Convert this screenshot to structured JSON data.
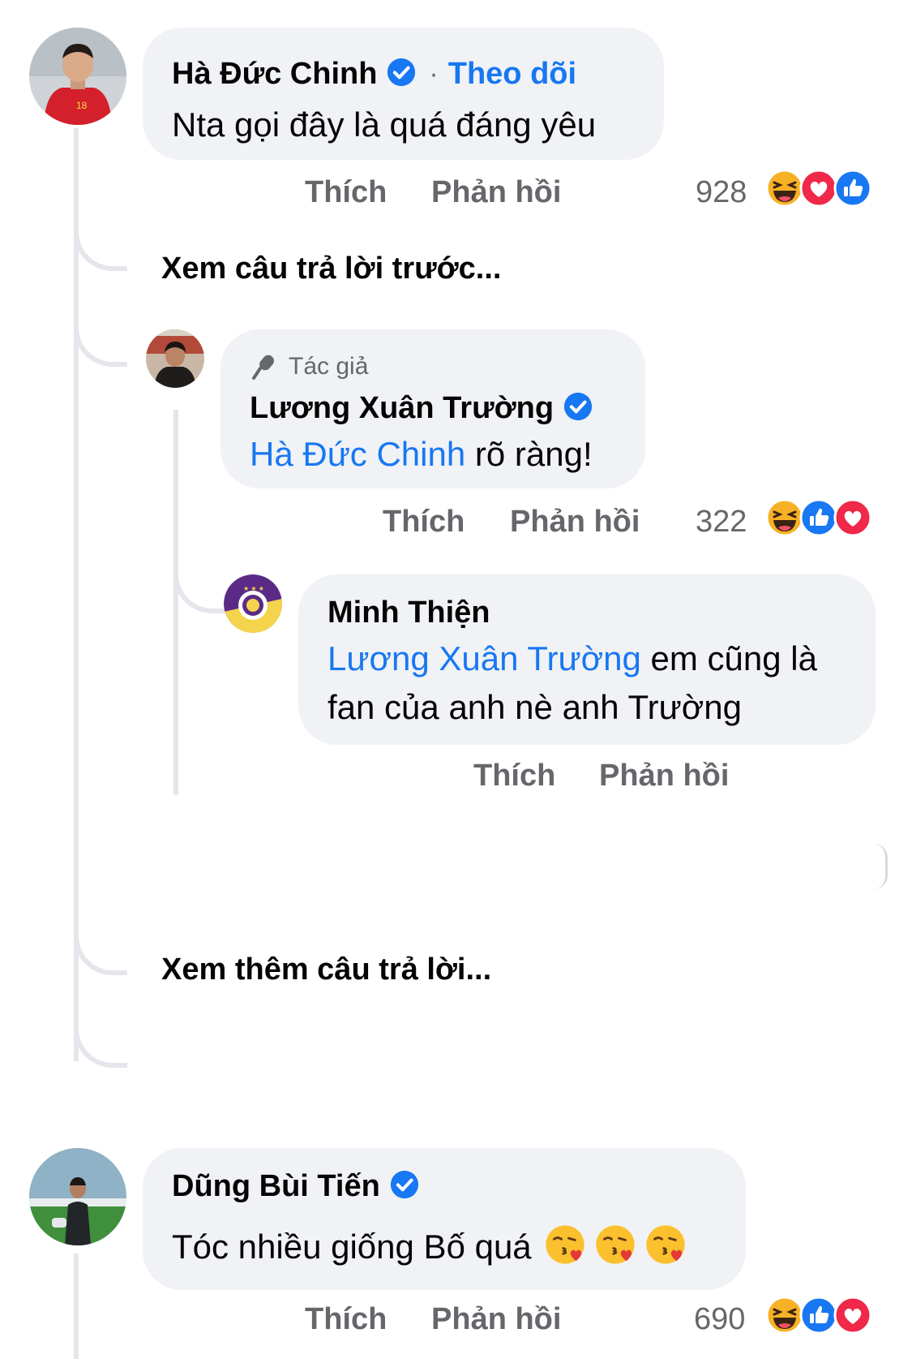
{
  "comments": {
    "c1": {
      "author": "Hà Đức Chinh",
      "follow_sep": "·",
      "follow_label": "Theo dõi",
      "text": "Nta gọi đây là quá đáng yêu",
      "like_label": "Thích",
      "reply_label": "Phản hồi",
      "reaction_count": "928",
      "reactions": [
        "haha-icon",
        "love-icon",
        "like-icon"
      ]
    },
    "view_previous": "Xem câu trả lời trước...",
    "c2": {
      "badge_label": "Tác giả",
      "author": "Lương Xuân Trường",
      "mention": "Hà Đức Chinh",
      "text": " rõ ràng!",
      "like_label": "Thích",
      "reply_label": "Phản hồi",
      "reaction_count": "322",
      "reactions": [
        "haha-icon",
        "like-icon",
        "love-icon"
      ]
    },
    "c3": {
      "author": "Minh Thiện",
      "mention": "Lương Xuân Trường",
      "text_line1": " em cũng là",
      "text_line2": "fan của anh nè anh Trường",
      "like_label": "Thích",
      "reply_label": "Phản hồi"
    },
    "view_more": "Xem thêm câu trả lời...",
    "c4": {
      "author": "Dũng Bùi Tiến",
      "text": "Tóc nhiều giống Bố quá",
      "emojis": [
        "kissing-heart-icon",
        "kissing-heart-icon",
        "kissing-heart-icon"
      ],
      "like_label": "Thích",
      "reply_label": "Phản hồi",
      "reaction_count": "690",
      "reactions": [
        "haha-icon",
        "like-icon",
        "love-icon"
      ]
    }
  },
  "colors": {
    "link": "#1877f2",
    "bubble": "#f0f2f5",
    "muted": "#65676b",
    "thread_line": "#e4e6eb"
  }
}
